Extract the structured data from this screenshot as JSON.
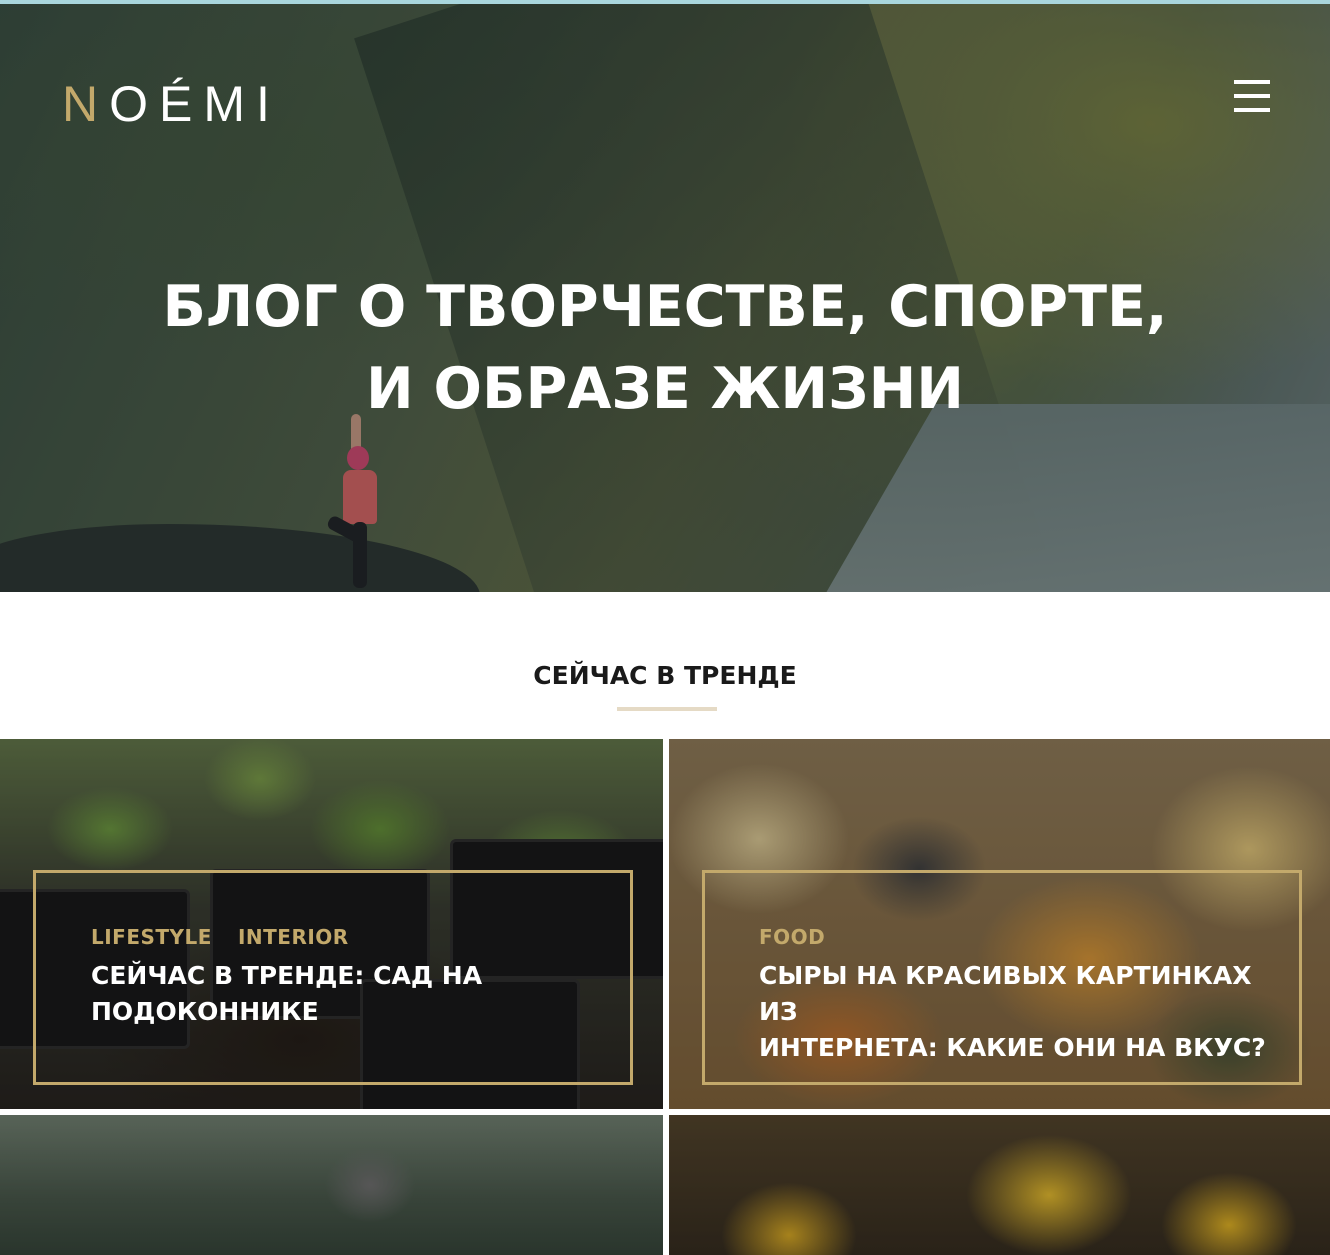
{
  "brand": {
    "logo_first": "N",
    "logo_rest": "OÉMI",
    "accent_color": "#c3a96b"
  },
  "header": {
    "menu_icon": "hamburger-menu-icon"
  },
  "hero": {
    "title_line1": "БЛОГ О ТВОРЧЕСТВЕ, СПОРТЕ,",
    "title_line2": "И ОБРАЗЕ ЖИЗНИ"
  },
  "trending": {
    "title": "СЕЙЧАС В ТРЕНДЕ",
    "cards": [
      {
        "categories": [
          "LIFESTYLE",
          "INTERIOR"
        ],
        "title_line1": "СЕЙЧАС В ТРЕНДЕ: САД НА",
        "title_line2": "ПОДОКОННИКЕ"
      },
      {
        "categories": [
          "FOOD"
        ],
        "title_line1": "СЫРЫ НА КРАСИВЫХ КАРТИНКАХ ИЗ",
        "title_line2": "ИНТЕРНЕТА: КАКИЕ ОНИ НА ВКУС?"
      }
    ]
  }
}
